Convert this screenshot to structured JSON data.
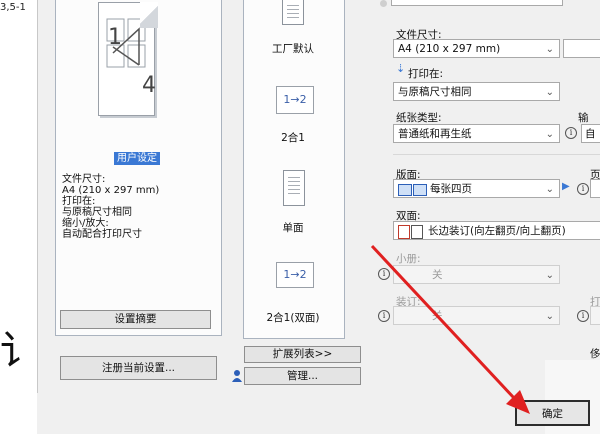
{
  "background": {
    "range_text": "3,5-1",
    "big_char": "讠"
  },
  "preview": {
    "page_numbers": {
      "one": "1",
      "four": "4"
    },
    "user_setting_label": "用户设定",
    "info_lines": [
      "文件尺寸:",
      " A4 (210 x 297 mm)",
      "打印在:",
      " 与原稿尺寸相同",
      "缩小/放大:",
      " 自动配合打印尺寸"
    ],
    "summary_button": "设置摘要",
    "register_button": "注册当前设置..."
  },
  "layouts": {
    "items": [
      {
        "label": "工厂默认"
      },
      {
        "icon_text": "1→2",
        "label": "2合1"
      },
      {
        "label": "单面"
      },
      {
        "icon_text": "1→2",
        "label": "2合1(双面)"
      }
    ],
    "expand_button": "扩展列表>>",
    "manage_button": "管理..."
  },
  "form": {
    "document_size": {
      "label": "文件尺寸:",
      "value": "A4 (210 x 297 mm)"
    },
    "print_on": {
      "label": "打印在:",
      "value": "与原稿尺寸相同"
    },
    "paper_type": {
      "label": "纸张类型:",
      "value": "普通纸和再生纸"
    },
    "paper_type_side": {
      "label_fragment": "输",
      "value_fragment": "自"
    },
    "layout": {
      "label": "版面:",
      "value": "每张四页"
    },
    "layout_side": {
      "label_fragment": "页"
    },
    "duplex": {
      "label": "双面:",
      "value": "长边装订(向左翻页/向上翻页)"
    },
    "booklet": {
      "label": "小册:",
      "value": "关"
    },
    "binding": {
      "label": "装订:",
      "value": "关"
    },
    "side_fragment_bottom": "打",
    "side_fragment_low": "侈"
  },
  "footer": {
    "ok_button": "确定"
  },
  "colors": {
    "arrow": "#e02020",
    "selection": "#3a78d4"
  }
}
